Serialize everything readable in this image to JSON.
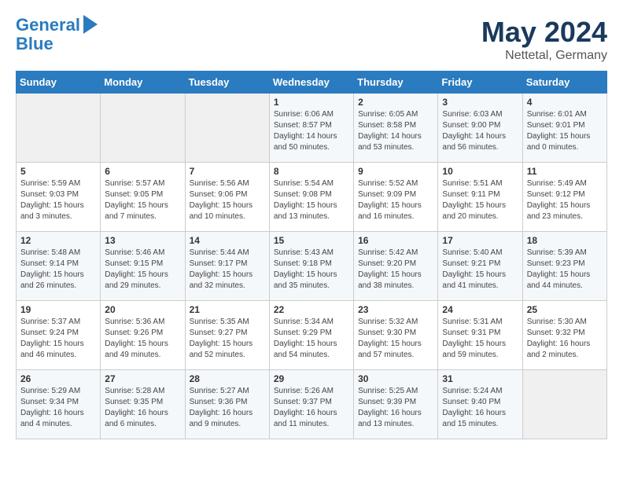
{
  "header": {
    "logo_line1": "General",
    "logo_line2": "Blue",
    "month": "May 2024",
    "location": "Nettetal, Germany"
  },
  "weekdays": [
    "Sunday",
    "Monday",
    "Tuesday",
    "Wednesday",
    "Thursday",
    "Friday",
    "Saturday"
  ],
  "weeks": [
    [
      {
        "day": "",
        "empty": true
      },
      {
        "day": "",
        "empty": true
      },
      {
        "day": "",
        "empty": true
      },
      {
        "day": "1",
        "sunrise": "Sunrise: 6:06 AM",
        "sunset": "Sunset: 8:57 PM",
        "daylight": "Daylight: 14 hours and 50 minutes."
      },
      {
        "day": "2",
        "sunrise": "Sunrise: 6:05 AM",
        "sunset": "Sunset: 8:58 PM",
        "daylight": "Daylight: 14 hours and 53 minutes."
      },
      {
        "day": "3",
        "sunrise": "Sunrise: 6:03 AM",
        "sunset": "Sunset: 9:00 PM",
        "daylight": "Daylight: 14 hours and 56 minutes."
      },
      {
        "day": "4",
        "sunrise": "Sunrise: 6:01 AM",
        "sunset": "Sunset: 9:01 PM",
        "daylight": "Daylight: 15 hours and 0 minutes."
      }
    ],
    [
      {
        "day": "5",
        "sunrise": "Sunrise: 5:59 AM",
        "sunset": "Sunset: 9:03 PM",
        "daylight": "Daylight: 15 hours and 3 minutes."
      },
      {
        "day": "6",
        "sunrise": "Sunrise: 5:57 AM",
        "sunset": "Sunset: 9:05 PM",
        "daylight": "Daylight: 15 hours and 7 minutes."
      },
      {
        "day": "7",
        "sunrise": "Sunrise: 5:56 AM",
        "sunset": "Sunset: 9:06 PM",
        "daylight": "Daylight: 15 hours and 10 minutes."
      },
      {
        "day": "8",
        "sunrise": "Sunrise: 5:54 AM",
        "sunset": "Sunset: 9:08 PM",
        "daylight": "Daylight: 15 hours and 13 minutes."
      },
      {
        "day": "9",
        "sunrise": "Sunrise: 5:52 AM",
        "sunset": "Sunset: 9:09 PM",
        "daylight": "Daylight: 15 hours and 16 minutes."
      },
      {
        "day": "10",
        "sunrise": "Sunrise: 5:51 AM",
        "sunset": "Sunset: 9:11 PM",
        "daylight": "Daylight: 15 hours and 20 minutes."
      },
      {
        "day": "11",
        "sunrise": "Sunrise: 5:49 AM",
        "sunset": "Sunset: 9:12 PM",
        "daylight": "Daylight: 15 hours and 23 minutes."
      }
    ],
    [
      {
        "day": "12",
        "sunrise": "Sunrise: 5:48 AM",
        "sunset": "Sunset: 9:14 PM",
        "daylight": "Daylight: 15 hours and 26 minutes."
      },
      {
        "day": "13",
        "sunrise": "Sunrise: 5:46 AM",
        "sunset": "Sunset: 9:15 PM",
        "daylight": "Daylight: 15 hours and 29 minutes."
      },
      {
        "day": "14",
        "sunrise": "Sunrise: 5:44 AM",
        "sunset": "Sunset: 9:17 PM",
        "daylight": "Daylight: 15 hours and 32 minutes."
      },
      {
        "day": "15",
        "sunrise": "Sunrise: 5:43 AM",
        "sunset": "Sunset: 9:18 PM",
        "daylight": "Daylight: 15 hours and 35 minutes."
      },
      {
        "day": "16",
        "sunrise": "Sunrise: 5:42 AM",
        "sunset": "Sunset: 9:20 PM",
        "daylight": "Daylight: 15 hours and 38 minutes."
      },
      {
        "day": "17",
        "sunrise": "Sunrise: 5:40 AM",
        "sunset": "Sunset: 9:21 PM",
        "daylight": "Daylight: 15 hours and 41 minutes."
      },
      {
        "day": "18",
        "sunrise": "Sunrise: 5:39 AM",
        "sunset": "Sunset: 9:23 PM",
        "daylight": "Daylight: 15 hours and 44 minutes."
      }
    ],
    [
      {
        "day": "19",
        "sunrise": "Sunrise: 5:37 AM",
        "sunset": "Sunset: 9:24 PM",
        "daylight": "Daylight: 15 hours and 46 minutes."
      },
      {
        "day": "20",
        "sunrise": "Sunrise: 5:36 AM",
        "sunset": "Sunset: 9:26 PM",
        "daylight": "Daylight: 15 hours and 49 minutes."
      },
      {
        "day": "21",
        "sunrise": "Sunrise: 5:35 AM",
        "sunset": "Sunset: 9:27 PM",
        "daylight": "Daylight: 15 hours and 52 minutes."
      },
      {
        "day": "22",
        "sunrise": "Sunrise: 5:34 AM",
        "sunset": "Sunset: 9:29 PM",
        "daylight": "Daylight: 15 hours and 54 minutes."
      },
      {
        "day": "23",
        "sunrise": "Sunrise: 5:32 AM",
        "sunset": "Sunset: 9:30 PM",
        "daylight": "Daylight: 15 hours and 57 minutes."
      },
      {
        "day": "24",
        "sunrise": "Sunrise: 5:31 AM",
        "sunset": "Sunset: 9:31 PM",
        "daylight": "Daylight: 15 hours and 59 minutes."
      },
      {
        "day": "25",
        "sunrise": "Sunrise: 5:30 AM",
        "sunset": "Sunset: 9:32 PM",
        "daylight": "Daylight: 16 hours and 2 minutes."
      }
    ],
    [
      {
        "day": "26",
        "sunrise": "Sunrise: 5:29 AM",
        "sunset": "Sunset: 9:34 PM",
        "daylight": "Daylight: 16 hours and 4 minutes."
      },
      {
        "day": "27",
        "sunrise": "Sunrise: 5:28 AM",
        "sunset": "Sunset: 9:35 PM",
        "daylight": "Daylight: 16 hours and 6 minutes."
      },
      {
        "day": "28",
        "sunrise": "Sunrise: 5:27 AM",
        "sunset": "Sunset: 9:36 PM",
        "daylight": "Daylight: 16 hours and 9 minutes."
      },
      {
        "day": "29",
        "sunrise": "Sunrise: 5:26 AM",
        "sunset": "Sunset: 9:37 PM",
        "daylight": "Daylight: 16 hours and 11 minutes."
      },
      {
        "day": "30",
        "sunrise": "Sunrise: 5:25 AM",
        "sunset": "Sunset: 9:39 PM",
        "daylight": "Daylight: 16 hours and 13 minutes."
      },
      {
        "day": "31",
        "sunrise": "Sunrise: 5:24 AM",
        "sunset": "Sunset: 9:40 PM",
        "daylight": "Daylight: 16 hours and 15 minutes."
      },
      {
        "day": "",
        "empty": true
      }
    ]
  ]
}
